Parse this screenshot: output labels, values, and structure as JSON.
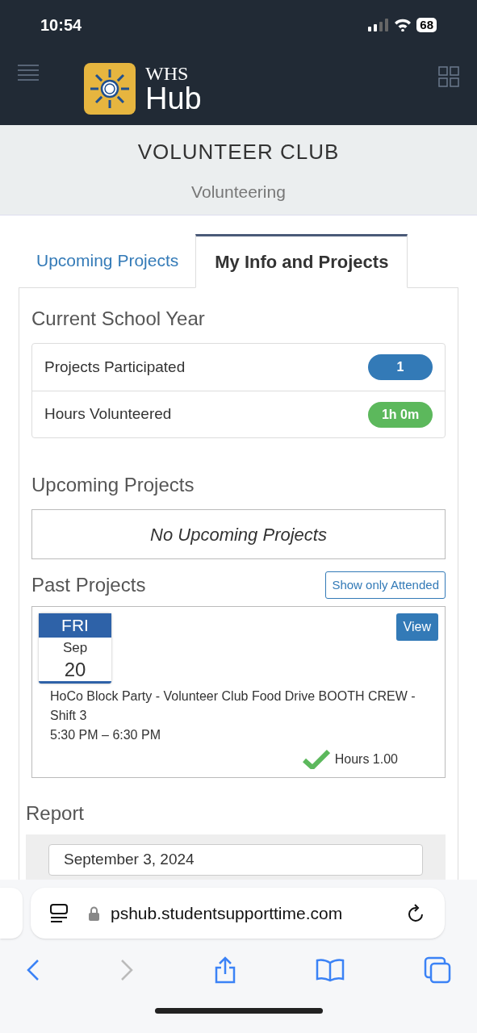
{
  "status_bar": {
    "time": "10:54",
    "battery": "68"
  },
  "header": {
    "logo_top": "WHS",
    "logo_bottom": "Hub"
  },
  "page": {
    "title": "VOLUNTEER CLUB",
    "subtitle": "Volunteering"
  },
  "tabs": [
    {
      "label": "Upcoming Projects",
      "selected": false
    },
    {
      "label": "My Info and Projects",
      "selected": true
    }
  ],
  "current_year": {
    "heading": "Current School Year",
    "stats": [
      {
        "label": "Projects Participated",
        "value": "1",
        "color": "#337ab7"
      },
      {
        "label": "Hours Volunteered",
        "value": "1h 0m",
        "color": "#5cb85c"
      }
    ]
  },
  "upcoming": {
    "heading": "Upcoming Projects",
    "empty_text": "No Upcoming Projects"
  },
  "past": {
    "heading": "Past Projects",
    "filter_button": "Show only Attended",
    "projects": [
      {
        "weekday": "FRI",
        "month": "Sep",
        "day": "20",
        "title": "HoCo Block Party - Volunteer Club Food Drive BOOTH CREW - Shift 3",
        "time": "5:30 PM – 6:30 PM",
        "attended": true,
        "hours": "Hours 1.00",
        "view_button": "View"
      }
    ]
  },
  "report": {
    "heading": "Report",
    "date_value": "September 3, 2024"
  },
  "browser": {
    "url": "pshub.studentsupporttime.com"
  }
}
